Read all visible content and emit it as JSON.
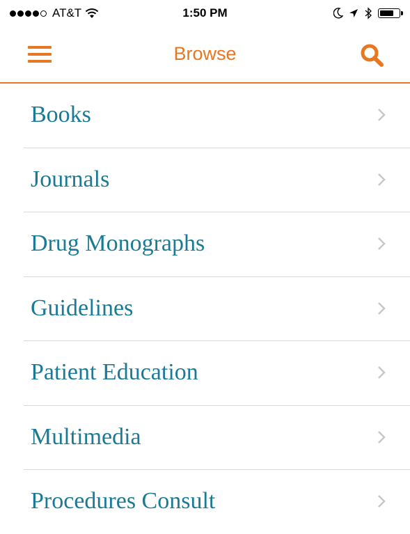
{
  "status_bar": {
    "carrier": "AT&T",
    "time": "1:50 PM",
    "signal_bars_filled": 4,
    "signal_bars_total": 5
  },
  "nav": {
    "title": "Browse",
    "menu_icon": "hamburger-menu-icon",
    "search_icon": "search-icon"
  },
  "list": {
    "items": [
      {
        "label": "Books"
      },
      {
        "label": "Journals"
      },
      {
        "label": "Drug Monographs"
      },
      {
        "label": "Guidelines"
      },
      {
        "label": "Patient Education"
      },
      {
        "label": "Multimedia"
      },
      {
        "label": "Procedures Consult"
      }
    ]
  },
  "colors": {
    "accent": "#e87722",
    "link": "#1b7a96",
    "divider": "#d9d9d9",
    "chevron": "#c7c7cc"
  }
}
